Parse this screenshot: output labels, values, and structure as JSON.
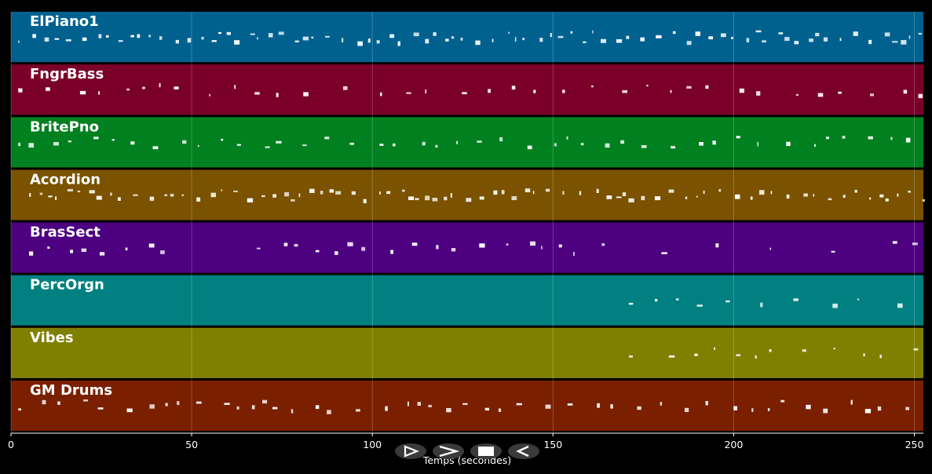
{
  "chart_data": {
    "type": "piano-roll",
    "xlabel": "Temps (secondes)",
    "xlim": [
      0,
      252.5
    ],
    "xticks": [
      0,
      50,
      100,
      150,
      200,
      250
    ],
    "grid": true,
    "tracks": [
      {
        "name": "ElPiano1",
        "color": "#00618f",
        "spans": [
          [
            2,
            252.5
          ]
        ],
        "density": "high"
      },
      {
        "name": "FngrBass",
        "color": "#7b0029",
        "spans": [
          [
            2,
            252.5
          ]
        ],
        "density": "low"
      },
      {
        "name": "BritePno",
        "color": "#00801f",
        "spans": [
          [
            2,
            252.5
          ]
        ],
        "density": "medium"
      },
      {
        "name": "Acordion",
        "color": "#7a5200",
        "spans": [
          [
            5,
            252.5
          ]
        ],
        "density": "high"
      },
      {
        "name": "BrasSect",
        "color": "#4d0080",
        "spans": [
          [
            5,
            43
          ],
          [
            68,
            100
          ],
          [
            105,
            168
          ],
          [
            180,
            183
          ],
          [
            195,
            198
          ],
          [
            210,
            215
          ],
          [
            227,
            231
          ],
          [
            244,
            252.5
          ]
        ],
        "density": "medium"
      },
      {
        "name": "PercOrgn",
        "color": "#008080",
        "spans": [
          [
            171,
            252.5
          ]
        ],
        "density": "low"
      },
      {
        "name": "Vibes",
        "color": "#808000",
        "spans": [
          [
            171,
            252.5
          ]
        ],
        "density": "low"
      },
      {
        "name": "GM Drums",
        "color": "#7a1f00",
        "spans": [
          [
            2,
            252.5
          ]
        ],
        "density": "medium"
      }
    ]
  },
  "controls": [
    {
      "name": "play",
      "icon": "play-outline-icon"
    },
    {
      "name": "forward",
      "icon": "chevron-right-icon"
    },
    {
      "name": "stop",
      "icon": "stop-icon"
    },
    {
      "name": "rewind",
      "icon": "rewind-icon"
    }
  ]
}
